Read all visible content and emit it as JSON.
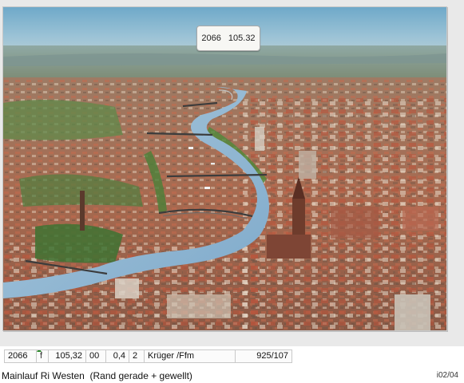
{
  "photo": {
    "subject": "Aerial view of Frankfurt am Main along the river Main, looking west",
    "sticker": {
      "number": "2066",
      "price": "105.32"
    }
  },
  "record": {
    "id": "2066",
    "flag": "f",
    "price": "105,32",
    "col_00": "00",
    "col_04": "0,4",
    "col_2": "2",
    "publisher": "Krüger /Ffm",
    "reference": "925/107"
  },
  "caption": {
    "title": "Mainlauf Ri Westen  (Rand gerade + gewellt)",
    "code": "i02/04"
  }
}
